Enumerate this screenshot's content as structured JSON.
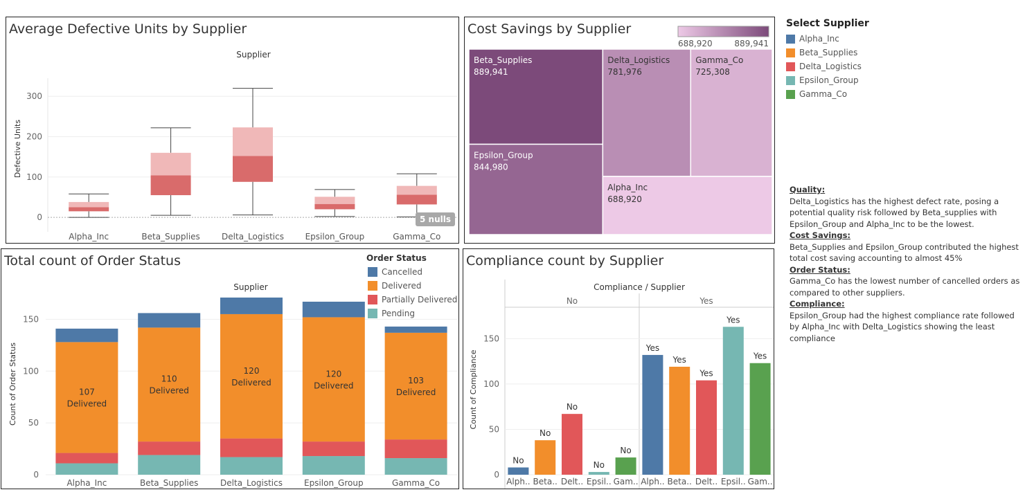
{
  "supplier_legend": {
    "title": "Select Supplier",
    "items": [
      {
        "label": "Alpha_Inc",
        "color": "#4e79a7"
      },
      {
        "label": "Beta_Supplies",
        "color": "#f28e2b"
      },
      {
        "label": "Delta_Logistics",
        "color": "#e15759"
      },
      {
        "label": "Epsilon_Group",
        "color": "#76b7b2"
      },
      {
        "label": "Gamma_Co",
        "color": "#59a14f"
      }
    ]
  },
  "insights": {
    "quality_heading": "Quality:",
    "quality_text": "Delta_Logistics has the highest defect rate, posing a potential quality risk followed by Beta_supplies with Epsilon_Group and Alpha_Inc to be the lowest.",
    "cost_heading": "Cost Savings:",
    "cost_text": "Beta_Supplies and Epsilon_Group contributed the highest total cost saving accounting to almost 45%",
    "order_heading": "Order Status:",
    "order_text": "Gamma_Co has the lowest number of cancelled orders as compared to other suppliers.",
    "compliance_heading": "Compliance:",
    "compliance_text": "Epsilon_Group had the highest compliance rate followed by Alpha_Inc with Delta_Logistics showing the least compliance"
  },
  "chart_data": [
    {
      "type": "box",
      "title": "Average Defective Units by Supplier",
      "header": "Supplier",
      "ylabel": "Defective Units",
      "ylim": [
        -5,
        345
      ],
      "yticks": [
        0,
        100,
        200,
        300
      ],
      "null_badge": "5 nulls",
      "categories": [
        "Alpha_Inc",
        "Beta_Supplies",
        "Delta_Logistics",
        "Epsilon_Group",
        "Gamma_Co"
      ],
      "boxes": [
        {
          "min": 0,
          "q1": 15,
          "median": 25,
          "q3": 38,
          "max": 58
        },
        {
          "min": 5,
          "q1": 55,
          "median": 104,
          "q3": 160,
          "max": 222
        },
        {
          "min": 6,
          "q1": 88,
          "median": 152,
          "q3": 223,
          "max": 320
        },
        {
          "min": 2,
          "q1": 20,
          "median": 33,
          "q3": 51,
          "max": 69
        },
        {
          "min": 1,
          "q1": 32,
          "median": 56,
          "q3": 78,
          "max": 108
        }
      ],
      "colors": {
        "upper": "#f0b8b8",
        "lower": "#d96b6b"
      }
    },
    {
      "type": "treemap",
      "title": "Cost Savings by Supplier",
      "legend_min_label": "688,920",
      "legend_max_label": "889,941",
      "color_min": "#edc9e6",
      "color_max": "#7c4a7a",
      "items": [
        {
          "name": "Beta_Supplies",
          "value": 889941,
          "value_label": "889,941"
        },
        {
          "name": "Epsilon_Group",
          "value": 844980,
          "value_label": "844,980"
        },
        {
          "name": "Delta_Logistics",
          "value": 781976,
          "value_label": "781,976"
        },
        {
          "name": "Gamma_Co",
          "value": 725308,
          "value_label": "725,308"
        },
        {
          "name": "Alpha_Inc",
          "value": 688920,
          "value_label": "688,920"
        }
      ]
    },
    {
      "type": "bar",
      "stacked": true,
      "title": "Total count of Order Status",
      "header": "Supplier",
      "ylabel": "Count of Order Status",
      "ylim": [
        0,
        175
      ],
      "yticks": [
        0,
        50,
        100,
        150
      ],
      "categories": [
        "Alpha_Inc",
        "Beta_Supplies",
        "Delta_Logistics",
        "Epsilon_Group",
        "Gamma_Co"
      ],
      "legend_title": "Order Status",
      "series": [
        {
          "name": "Pending",
          "color": "#76b7b2",
          "values": [
            11,
            19,
            17,
            18,
            16
          ]
        },
        {
          "name": "Partially Delivered",
          "color": "#e15759",
          "values": [
            10,
            13,
            18,
            14,
            18
          ]
        },
        {
          "name": "Delivered",
          "color": "#f28e2b",
          "values": [
            107,
            110,
            120,
            120,
            103
          ]
        },
        {
          "name": "Cancelled",
          "color": "#4e79a7",
          "values": [
            13,
            14,
            16,
            15,
            6
          ]
        }
      ],
      "legend_order": [
        "Cancelled",
        "Delivered",
        "Partially Delivered",
        "Pending"
      ],
      "delivered_labels": [
        {
          "value": "107",
          "label": "Delivered"
        },
        {
          "value": "110",
          "label": "Delivered"
        },
        {
          "value": "120",
          "label": "Delivered"
        },
        {
          "value": "120",
          "label": "Delivered"
        },
        {
          "value": "103",
          "label": "Delivered"
        }
      ]
    },
    {
      "type": "bar",
      "title": "Compliance count by Supplier",
      "header": "Compliance / Supplier",
      "ylabel": "Count of Compliance",
      "ylim": [
        0,
        180
      ],
      "yticks": [
        0,
        50,
        100,
        150
      ],
      "groups": [
        {
          "name": "No",
          "tick_labels": [
            "Alph..",
            "Beta..",
            "Delt..",
            "Epsil..",
            "Gam.."
          ],
          "values": [
            8,
            38,
            67,
            3,
            19
          ],
          "bar_labels": [
            "No",
            "No",
            "No",
            "No",
            "No"
          ]
        },
        {
          "name": "Yes",
          "tick_labels": [
            "Alph..",
            "Beta..",
            "Delt..",
            "Epsil..",
            "Gam.."
          ],
          "values": [
            132,
            119,
            104,
            163,
            123
          ],
          "bar_labels": [
            "Yes",
            "Yes",
            "Yes",
            "Yes",
            "Yes"
          ]
        }
      ],
      "colors": [
        "#4e79a7",
        "#f28e2b",
        "#e15759",
        "#76b7b2",
        "#59a14f"
      ]
    }
  ]
}
